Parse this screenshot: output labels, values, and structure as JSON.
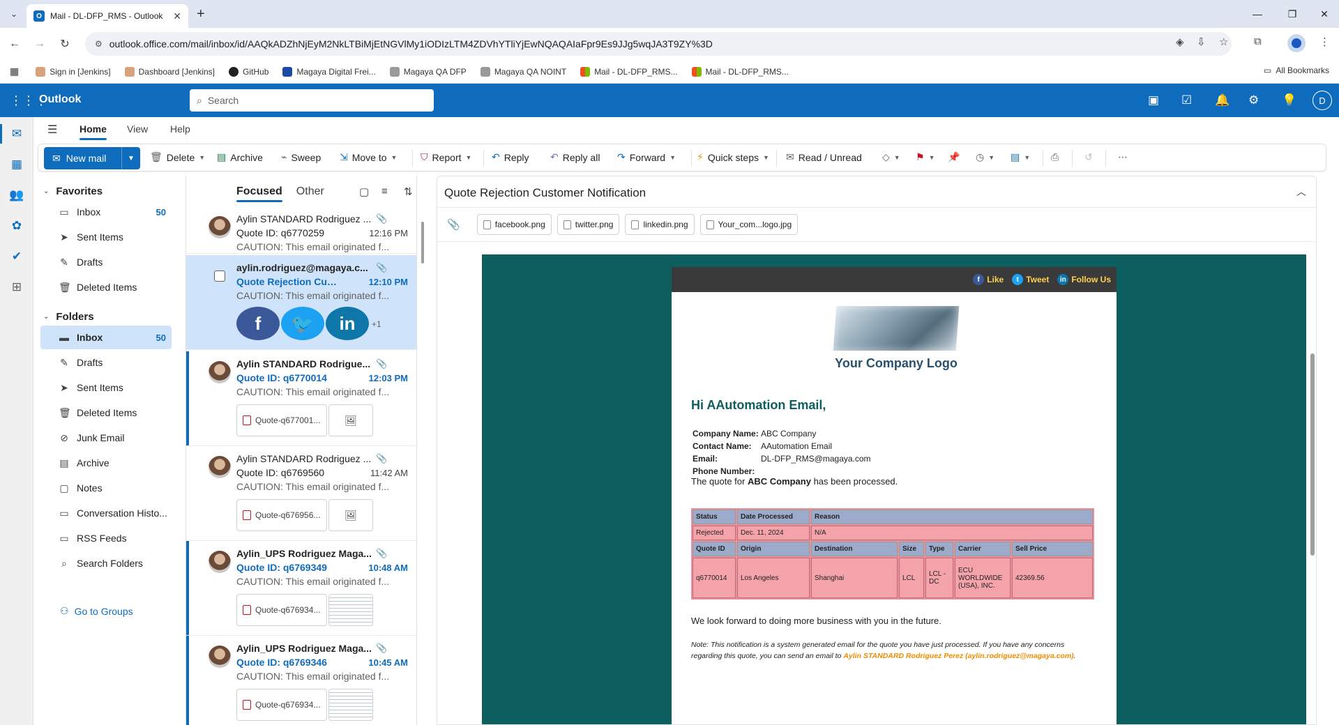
{
  "browser": {
    "tab_title": "Mail - DL-DFP_RMS - Outlook",
    "url": "outlook.office.com/mail/inbox/id/AAQkADZhNjEyM2NkLTBiMjEtNGVlMy1iODIzLTM4ZDVhYTliYjEwNQAQAIaFpr9Es9JJg5wqJA3T9ZY%3D",
    "bookmarks": [
      "Sign in [Jenkins]",
      "Dashboard [Jenkins]",
      "GitHub",
      "Magaya Digital Frei...",
      "Magaya QA DFP",
      "Magaya QA NOINT",
      "Mail - DL-DFP_RMS...",
      "Mail - DL-DFP_RMS..."
    ],
    "all_bookmarks": "All Bookmarks"
  },
  "outlook": {
    "brand": "Outlook",
    "search_placeholder": "Search",
    "avatar_initial": "D"
  },
  "ribbon": {
    "tabs": [
      "Home",
      "View",
      "Help"
    ],
    "new_mail": "New mail",
    "delete": "Delete",
    "archive": "Archive",
    "sweep": "Sweep",
    "move_to": "Move to",
    "report": "Report",
    "reply": "Reply",
    "reply_all": "Reply all",
    "forward": "Forward",
    "quick_steps": "Quick steps",
    "read_unread": "Read / Unread"
  },
  "folders": {
    "favorites_label": "Favorites",
    "favorites": [
      {
        "name": "Inbox",
        "count": "50"
      },
      {
        "name": "Sent Items",
        "count": ""
      },
      {
        "name": "Drafts",
        "count": ""
      },
      {
        "name": "Deleted Items",
        "count": ""
      }
    ],
    "folders_label": "Folders",
    "items": [
      {
        "name": "Inbox",
        "count": "50"
      },
      {
        "name": "Drafts",
        "count": ""
      },
      {
        "name": "Sent Items",
        "count": ""
      },
      {
        "name": "Deleted Items",
        "count": ""
      },
      {
        "name": "Junk Email",
        "count": ""
      },
      {
        "name": "Archive",
        "count": ""
      },
      {
        "name": "Notes",
        "count": ""
      },
      {
        "name": "Conversation Histo...",
        "count": ""
      },
      {
        "name": "RSS Feeds",
        "count": ""
      },
      {
        "name": "Search Folders",
        "count": ""
      }
    ],
    "go_to_groups": "Go to Groups"
  },
  "message_list": {
    "tab_focused": "Focused",
    "tab_other": "Other",
    "messages": [
      {
        "from": "Aylin STANDARD Rodriguez ...",
        "subject": "Quote ID: q6770259",
        "time": "12:16 PM",
        "preview": "CAUTION: This email originated f..."
      },
      {
        "from": "aylin.rodriguez@magaya.c...",
        "subject": "Quote Rejection Cust...",
        "time": "12:10 PM",
        "preview": "CAUTION: This email originated f...",
        "extra": "+1"
      },
      {
        "from": "Aylin STANDARD Rodrigue...",
        "subject": "Quote ID: q6770014",
        "time": "12:03 PM",
        "preview": "CAUTION: This email originated f...",
        "attachment": "Quote-q677001..."
      },
      {
        "from": "Aylin STANDARD Rodriguez ...",
        "subject": "Quote ID: q6769560",
        "time": "11:42 AM",
        "preview": "CAUTION: This email originated f...",
        "attachment": "Quote-q676956..."
      },
      {
        "from": "Aylin_UPS Rodriguez Maga...",
        "subject": "Quote ID: q6769349",
        "time": "10:48 AM",
        "preview": "CAUTION: This email originated f...",
        "attachment": "Quote-q676934..."
      },
      {
        "from": "Aylin_UPS Rodriguez Maga...",
        "subject": "Quote ID: q6769346",
        "time": "10:45 AM",
        "preview": "CAUTION: This email originated f...",
        "attachment": "Quote-q676934..."
      }
    ]
  },
  "reading": {
    "subject": "Quote Rejection Customer Notification",
    "attachments": [
      "facebook.png",
      "twitter.png",
      "linkedin.png",
      "Your_com...logo.jpg"
    ],
    "social": {
      "like": "Like",
      "tweet": "Tweet",
      "follow": "Follow Us"
    },
    "logo_text": "Your Company Logo",
    "greeting": "Hi AAutomation Email,",
    "fields": [
      {
        "label": "Company Name:",
        "value": "ABC Company"
      },
      {
        "label": "Contact Name:",
        "value": "AAutomation Email"
      },
      {
        "label": "Email:",
        "value": "DL-DFP_RMS@magaya.com"
      },
      {
        "label": "Phone Number:",
        "value": ""
      }
    ],
    "processed_pre": "The quote for ",
    "processed_company": "ABC Company",
    "processed_post": " has been processed.",
    "table1": {
      "headers": [
        "Status",
        "Date Processed",
        "Reason"
      ],
      "row": [
        "Rejected",
        "Dec. 11, 2024",
        "N/A"
      ]
    },
    "table2": {
      "headers": [
        "Quote ID",
        "Origin",
        "Destination",
        "Size",
        "Type",
        "Carrier",
        "Sell Price"
      ],
      "row": [
        "q6770014",
        "Los Angeles",
        "Shanghai",
        "LCL",
        "LCL - DC",
        "ECU WORLDWIDE (USA), INC.",
        "42369.56"
      ]
    },
    "forward_text": "We look forward to doing more business with you in the future.",
    "note_pre": "Note: This notification is a system generated email for the quote you have just processed. If you have any concerns regarding this quote, you can send an email to ",
    "note_contact": "Aylin STANDARD Rodriguez Perez (aylin.rodriguez@magaya.com)",
    "note_post": "."
  },
  "colors": {
    "brand_blue": "#0f6cbd",
    "email_bg": "#0d5e5e",
    "table_header": "#9cabc9",
    "table_cell": "#f5a3ab"
  }
}
